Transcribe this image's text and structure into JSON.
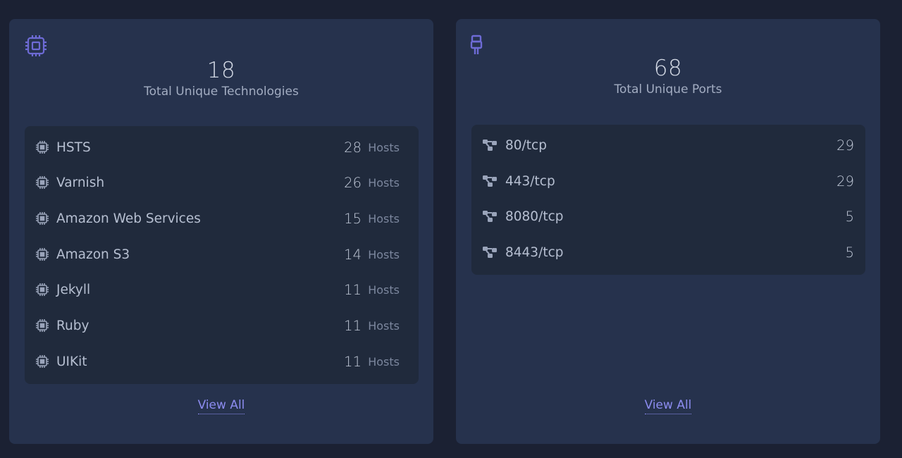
{
  "technologies": {
    "total": "18",
    "label": "Total Unique Technologies",
    "icon": "cpu-chip-icon",
    "items": [
      {
        "name": "HSTS",
        "count": "28",
        "unit": "Hosts"
      },
      {
        "name": "Varnish",
        "count": "26",
        "unit": "Hosts"
      },
      {
        "name": "Amazon Web Services",
        "count": "15",
        "unit": "Hosts"
      },
      {
        "name": "Amazon S3",
        "count": "14",
        "unit": "Hosts"
      },
      {
        "name": "Jekyll",
        "count": "11",
        "unit": "Hosts"
      },
      {
        "name": "Ruby",
        "count": "11",
        "unit": "Hosts"
      },
      {
        "name": "UIKit",
        "count": "11",
        "unit": "Hosts"
      }
    ],
    "view_all": "View All"
  },
  "ports": {
    "total": "68",
    "label": "Total Unique Ports",
    "icon": "plug-icon",
    "items": [
      {
        "name": "80/tcp",
        "count": "29"
      },
      {
        "name": "443/tcp",
        "count": "29"
      },
      {
        "name": "8080/tcp",
        "count": "5"
      },
      {
        "name": "8443/tcp",
        "count": "5"
      }
    ],
    "view_all": "View All"
  },
  "colors": {
    "page_bg": "#1b2133",
    "card_bg": "#26324d",
    "list_bg": "#202a3c",
    "accent": "#6e6bd6",
    "link": "#8c8cf0"
  }
}
